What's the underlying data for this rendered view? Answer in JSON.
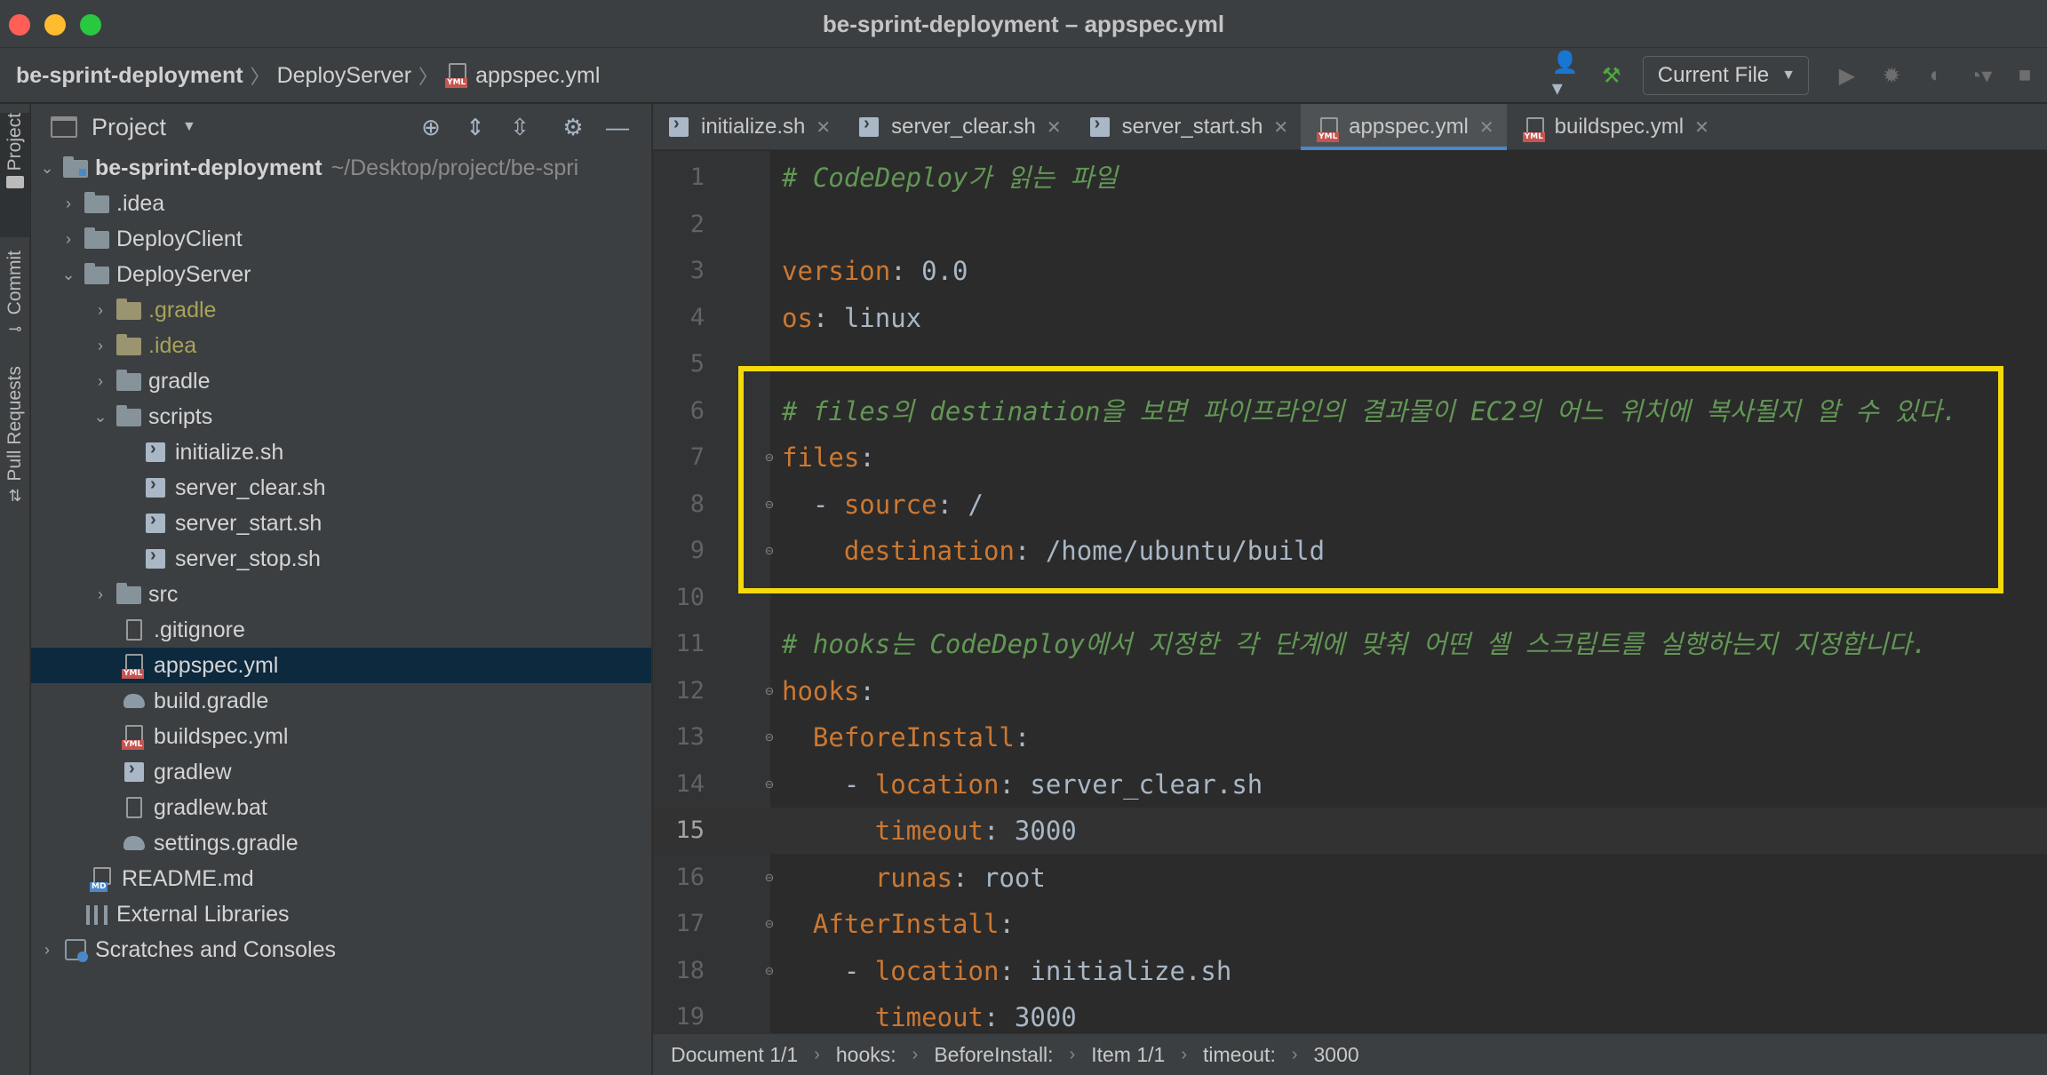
{
  "window": {
    "title": "be-sprint-deployment – appspec.yml"
  },
  "navbar": {
    "breadcrumbs": [
      "be-sprint-deployment",
      "DeployServer",
      "appspec.yml"
    ],
    "run_config": "Current File"
  },
  "stripe": {
    "items": [
      "Project",
      "Commit",
      "Pull Requests"
    ]
  },
  "project_panel": {
    "title": "Project",
    "tree": [
      {
        "label": "be-sprint-deployment",
        "extra": "~/Desktop/project/be-spri"
      },
      {
        "label": ".idea"
      },
      {
        "label": "DeployClient"
      },
      {
        "label": "DeployServer"
      },
      {
        "label": ".gradle"
      },
      {
        "label": ".idea"
      },
      {
        "label": "gradle"
      },
      {
        "label": "scripts"
      },
      {
        "label": "initialize.sh"
      },
      {
        "label": "server_clear.sh"
      },
      {
        "label": "server_start.sh"
      },
      {
        "label": "server_stop.sh"
      },
      {
        "label": "src"
      },
      {
        "label": ".gitignore"
      },
      {
        "label": "appspec.yml"
      },
      {
        "label": "build.gradle"
      },
      {
        "label": "buildspec.yml"
      },
      {
        "label": "gradlew"
      },
      {
        "label": "gradlew.bat"
      },
      {
        "label": "settings.gradle"
      },
      {
        "label": "README.md"
      },
      {
        "label": "External Libraries"
      },
      {
        "label": "Scratches and Consoles"
      }
    ]
  },
  "tabs": [
    "initialize.sh",
    "server_clear.sh",
    "server_start.sh",
    "appspec.yml",
    "buildspec.yml"
  ],
  "editor": {
    "lines": [
      {
        "n": "1",
        "text": "# CodeDeploy가 읽는 파일"
      },
      {
        "n": "2",
        "text": ""
      },
      {
        "n": "3",
        "key": "version",
        "value": "0.0"
      },
      {
        "n": "4",
        "key": "os",
        "value": "linux"
      },
      {
        "n": "5",
        "text": ""
      },
      {
        "n": "6",
        "text": "# files의 destination을 보면 파이프라인의 결과물이 EC2의 어느 위치에 복사될지 알 수 있다."
      },
      {
        "n": "7",
        "key": "files",
        "value": ""
      },
      {
        "n": "8",
        "dash": "- ",
        "key": "source",
        "value": "/"
      },
      {
        "n": "9",
        "key": "destination",
        "value": "/home/ubuntu/build"
      },
      {
        "n": "10",
        "text": ""
      },
      {
        "n": "11",
        "text": "# hooks는 CodeDeploy에서 지정한 각 단계에 맞춰 어떤 셸 스크립트를 실행하는지 지정합니다."
      },
      {
        "n": "12",
        "key": "hooks",
        "value": ""
      },
      {
        "n": "13",
        "key": "BeforeInstall",
        "value": ""
      },
      {
        "n": "14",
        "dash": "- ",
        "key": "location",
        "value": "server_clear.sh"
      },
      {
        "n": "15",
        "key": "timeout",
        "value": "3000"
      },
      {
        "n": "16",
        "key": "runas",
        "value": "root"
      },
      {
        "n": "17",
        "key": "AfterInstall",
        "value": ""
      },
      {
        "n": "18",
        "dash": "- ",
        "key": "location",
        "value": "initialize.sh"
      },
      {
        "n": "19",
        "key": "timeout",
        "value": "3000"
      }
    ]
  },
  "status_path": [
    "Document 1/1",
    "hooks:",
    "BeforeInstall:",
    "Item 1/1",
    "timeout:",
    "3000"
  ],
  "colors": {
    "highlight_box": "#f5d90a",
    "comment": "#629755",
    "key": "#cc7832",
    "value": "#a9b7c6",
    "selection": "#0d293e"
  }
}
